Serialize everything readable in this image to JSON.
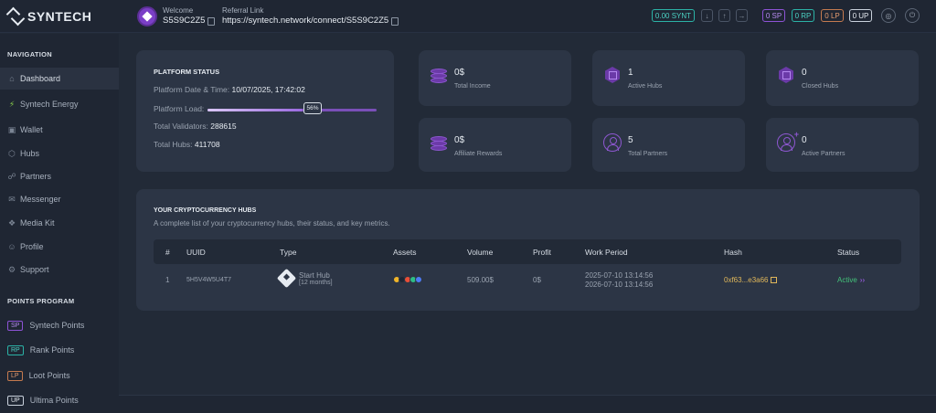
{
  "header": {
    "brand": "SYNTECH",
    "welcome_label": "Welcome",
    "username": "S5S9C2Z5",
    "referral_label": "Referral Link",
    "referral_link": "https://syntech.network/connect/S5S9C2Z5",
    "balance": "0.00 SYNT",
    "points": {
      "sp": "0 SP",
      "rp": "0 RP",
      "lp": "0 LP",
      "up": "0 UP"
    }
  },
  "sidebar": {
    "nav_heading": "NAVIGATION",
    "nav_items": [
      {
        "label": "Dashboard",
        "icon": "home-icon"
      },
      {
        "label": "Syntech Energy",
        "icon": "lightning-icon"
      },
      {
        "label": "Wallet",
        "icon": "wallet-icon"
      },
      {
        "label": "Hubs",
        "icon": "hub-icon"
      },
      {
        "label": "Partners",
        "icon": "partners-icon"
      },
      {
        "label": "Messenger",
        "icon": "message-icon"
      },
      {
        "label": "Media Kit",
        "icon": "media-icon"
      },
      {
        "label": "Profile",
        "icon": "user-icon"
      },
      {
        "label": "Support",
        "icon": "support-icon"
      }
    ],
    "points_heading": "POINTS PROGRAM",
    "points_items": [
      {
        "badge": "SP",
        "label": "Syntech Points",
        "color": "#8d53d6"
      },
      {
        "badge": "RP",
        "label": "Rank Points",
        "color": "#2bb2a6"
      },
      {
        "badge": "LP",
        "label": "Loot Points",
        "color": "#c47a4f"
      },
      {
        "badge": "UP",
        "label": "Ultima Points",
        "color": "#c9d1dc"
      }
    ]
  },
  "platform_status": {
    "title": "PLATFORM STATUS",
    "date_label": "Platform Date & Time:",
    "date_value": "10/07/2025, 17:42:02",
    "load_label": "Platform Load:",
    "load_percent": 56,
    "load_text": "56%",
    "validators_label": "Total Validators:",
    "validators_value": "288615",
    "hubs_label": "Total Hubs:",
    "hubs_value": "411708"
  },
  "stats": {
    "total_income": {
      "value": "0$",
      "label": "Total Income"
    },
    "active_hubs": {
      "value": "1",
      "label": "Active Hubs"
    },
    "closed_hubs": {
      "value": "0",
      "label": "Closed Hubs"
    },
    "affiliate_rewards": {
      "value": "0$",
      "label": "Affiliate Rewards"
    },
    "total_partners": {
      "value": "5",
      "label": "Total Partners"
    },
    "active_partners": {
      "value": "0",
      "label": "Active Partners"
    }
  },
  "hubs": {
    "title": "YOUR CRYPTOCURRENCY HUBS",
    "subtitle": "A complete list of your cryptocurrency hubs, their status, and key metrics.",
    "columns": {
      "num": "#",
      "uuid": "UUID",
      "type": "Type",
      "assets": "Assets",
      "volume": "Volume",
      "profit": "Profit",
      "period": "Work Period",
      "hash": "Hash",
      "status": "Status"
    },
    "rows": [
      {
        "num": "1",
        "uuid": "5H5V4W5U4T7",
        "type": "Start Hub",
        "duration": "[12 months]",
        "volume": "509.00$",
        "profit": "0$",
        "period_start": "2025-07-10 13:14:56",
        "period_end": "2026-07-10 13:14:56",
        "hash": "0xf63...e3a66",
        "status": "Active"
      }
    ]
  }
}
